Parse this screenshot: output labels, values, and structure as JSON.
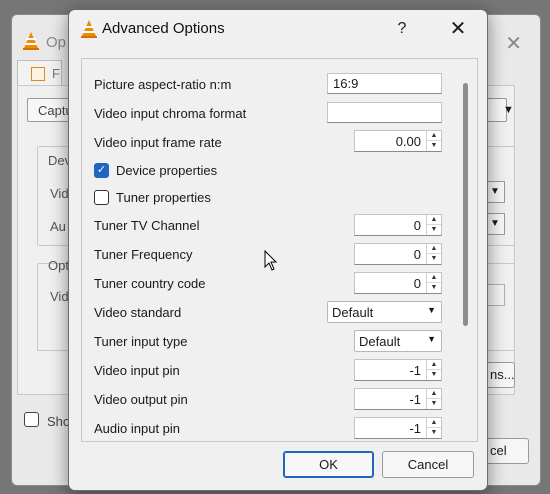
{
  "background_window": {
    "title": "Op",
    "tab_label": "F",
    "capture_combo": "Captu",
    "device_group": "Devi",
    "video_label": "Vid",
    "audio_label": "Au",
    "options_group": "Opti",
    "video_label2": "Vid",
    "more_button": "ns...",
    "show_label": "Sho",
    "cancel_button": "cel"
  },
  "dialog": {
    "title": "Advanced Options",
    "help_symbol": "?",
    "close_symbol": "✕",
    "rows": {
      "aspect_ratio": {
        "label": "Picture aspect-ratio n:m",
        "value": "16:9"
      },
      "chroma": {
        "label": "Video input chroma format",
        "value": ""
      },
      "frame_rate": {
        "label": "Video input frame rate",
        "value": "0.00"
      },
      "device_props": {
        "label": "Device properties",
        "checked": true
      },
      "tuner_props": {
        "label": "Tuner properties",
        "checked": false
      },
      "tv_channel": {
        "label": "Tuner TV Channel",
        "value": "0"
      },
      "tuner_freq": {
        "label": "Tuner Frequency",
        "value": "0"
      },
      "country_code": {
        "label": "Tuner country code",
        "value": "0"
      },
      "video_standard": {
        "label": "Video standard",
        "value": "Default"
      },
      "input_type": {
        "label": "Tuner input type",
        "value": "Default"
      },
      "video_in_pin": {
        "label": "Video input pin",
        "value": "-1"
      },
      "video_out_pin": {
        "label": "Video output pin",
        "value": "-1"
      },
      "audio_in_pin": {
        "label": "Audio input pin",
        "value": "-1"
      }
    },
    "ok_label": "OK",
    "cancel_label": "Cancel"
  },
  "colors": {
    "accent": "#1f66c1",
    "vlc_orange": "#f08a00"
  }
}
